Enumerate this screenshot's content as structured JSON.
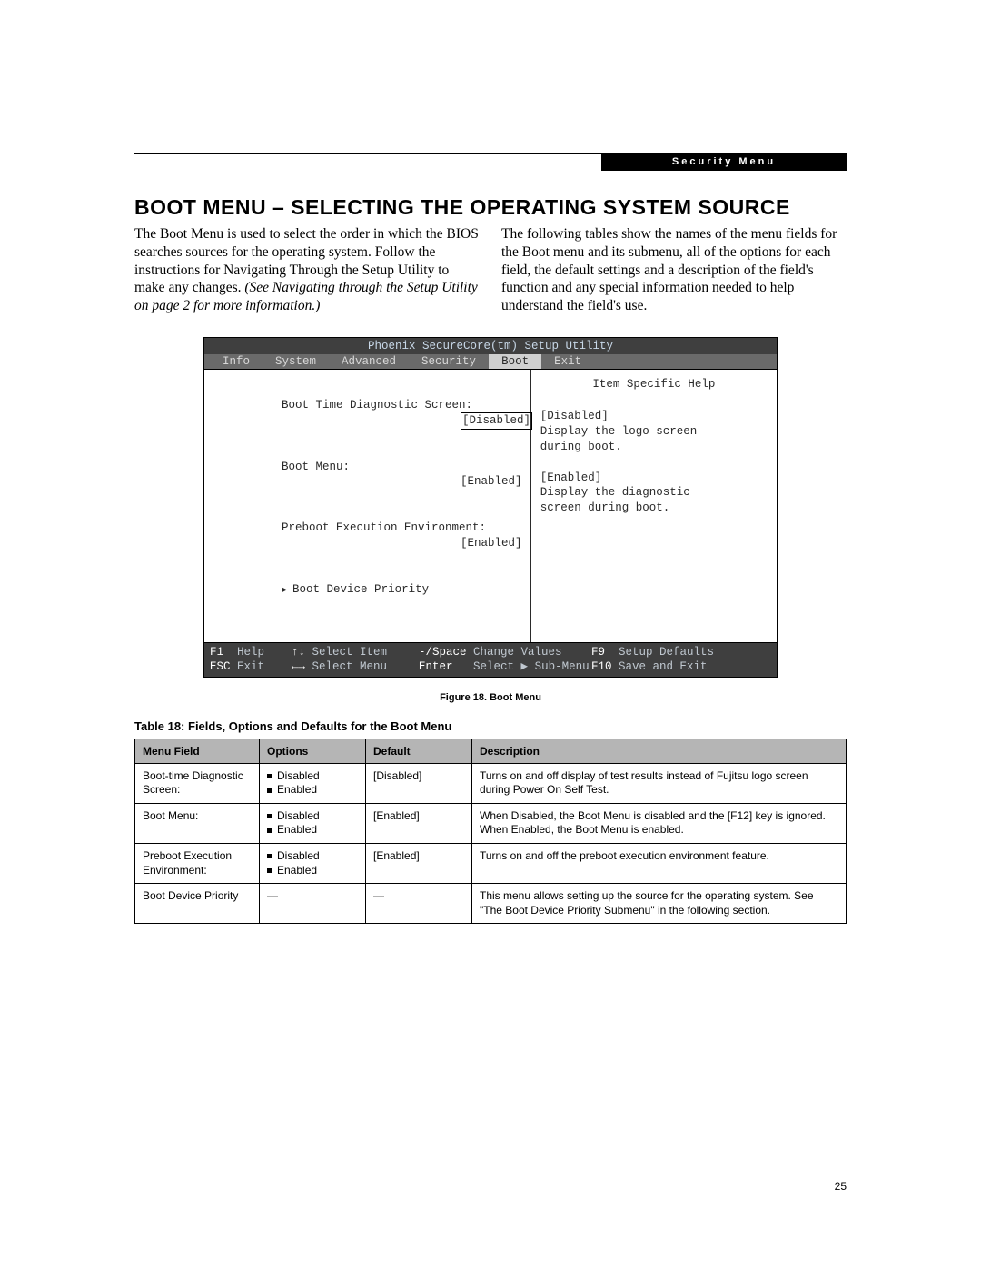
{
  "header": {
    "badge": "Security Menu"
  },
  "title": "BOOT MENU – SELECTING THE OPERATING SYSTEM SOURCE",
  "intro": {
    "left_1": "The Boot Menu is used to select the order in which the BIOS searches sources for the operating system. Follow the instructions for Navigating Through the Setup Utility to make any changes. ",
    "left_ital": "(See Navigating through the Setup Utility on page 2 for more information.)",
    "right": "The following tables show the names of the menu fields for the Boot menu and its submenu, all of the options for each field, the default settings and a description of the field's function and any special information needed to help understand the field's use."
  },
  "bios": {
    "title": "Phoenix SecureCore(tm) Setup Utility",
    "tabs": [
      "Info",
      "System",
      "Advanced",
      "Security",
      "Boot",
      "Exit"
    ],
    "active_tab": "Boot",
    "settings": [
      {
        "label": "Boot Time Diagnostic Screen:",
        "value": "[Disabled]",
        "selected": true
      },
      {
        "label": "Boot Menu:",
        "value": "[Enabled]",
        "selected": false
      },
      {
        "label": "Preboot Execution Environment:",
        "value": "[Enabled]",
        "selected": false
      }
    ],
    "submenu": "Boot Device Priority",
    "help_title": "Item Specific Help",
    "help_lines": [
      "[Disabled]",
      "Display the logo screen",
      "during boot.",
      "",
      "[Enabled]",
      "Display the diagnostic",
      "screen during boot."
    ],
    "footer": {
      "r1": {
        "k1": "F1",
        "t1": "Help",
        "k2": "↑↓",
        "t2": "Select Item",
        "k3": "-/Space",
        "t3": "Change Values",
        "k4": "F9",
        "t4": "Setup Defaults"
      },
      "r2": {
        "k1": "ESC",
        "t1": "Exit",
        "k2": "←→",
        "t2": "Select Menu",
        "k3": "Enter",
        "t3": "Select ▶ Sub-Menu",
        "k4": "F10",
        "t4": "Save and Exit"
      }
    }
  },
  "caption": "Figure 18.  Boot Menu",
  "table_title": "Table 18: Fields, Options and Defaults for the Boot Menu",
  "table_headers": {
    "mf": "Menu Field",
    "op": "Options",
    "df": "Default",
    "de": "Description"
  },
  "rows": [
    {
      "mf": "Boot-time Diagnostic Screen:",
      "opts": [
        "Disabled",
        "Enabled"
      ],
      "df": "[Disabled]",
      "de": "Turns on and off display of test results instead of Fujitsu logo screen during Power On Self Test."
    },
    {
      "mf": "Boot Menu:",
      "opts": [
        "Disabled",
        "Enabled"
      ],
      "df": "[Enabled]",
      "de": "When Disabled, the Boot Menu is disabled and the [F12] key is ignored. When Enabled, the Boot Menu is enabled."
    },
    {
      "mf": "Preboot Execution Environment:",
      "opts": [
        "Disabled",
        "Enabled"
      ],
      "df": "[Enabled]",
      "de": "Turns on and off the preboot execution environment feature."
    },
    {
      "mf": "Boot Device Priority",
      "opts": [],
      "df": "—",
      "de": "This menu allows setting up the source for the operating system. See \"The Boot Device Priority Submenu\" in the following section."
    }
  ],
  "page_number": "25"
}
